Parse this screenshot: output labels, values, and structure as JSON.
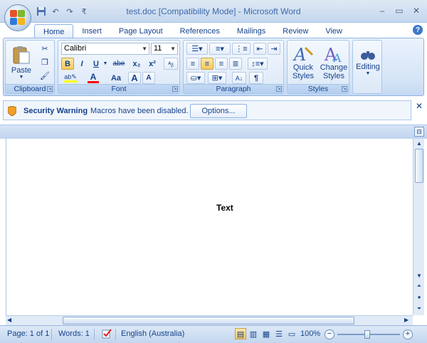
{
  "window": {
    "title": "test.doc [Compatibility Mode] - Microsoft Word",
    "controls": {
      "minimize": "–",
      "maximize": "▭",
      "close": "✕"
    }
  },
  "quick_access": {
    "customize": "₹"
  },
  "tabs": [
    {
      "label": "Home",
      "active": true
    },
    {
      "label": "Insert"
    },
    {
      "label": "Page Layout"
    },
    {
      "label": "References"
    },
    {
      "label": "Mailings"
    },
    {
      "label": "Review"
    },
    {
      "label": "View"
    }
  ],
  "ribbon": {
    "clipboard": {
      "label": "Clipboard",
      "paste_label": "Paste"
    },
    "font": {
      "label": "Font",
      "font_name": "Calibri",
      "font_size": "11",
      "bold": "B",
      "italic": "I",
      "underline": "U",
      "strikethrough": "abe",
      "subscript": "x₂",
      "superscript": "x²",
      "change_case": "Aa",
      "grow": "A",
      "shrink": "A"
    },
    "paragraph": {
      "label": "Paragraph",
      "show_marks": "¶"
    },
    "styles": {
      "label": "Styles",
      "quick_styles": "Quick Styles",
      "change_styles": "Change Styles"
    },
    "editing": {
      "label": "Editing"
    }
  },
  "security_bar": {
    "title": "Security Warning",
    "message": "Macros have been disabled.",
    "options_button": "Options...",
    "close": "✕"
  },
  "document": {
    "text": "Text"
  },
  "status_bar": {
    "page": "Page: 1 of 1",
    "words": "Words: 1",
    "language": "English (Australia)",
    "zoom": "100%"
  },
  "colors": {
    "accent": "#15428b",
    "ribbon_bg": "#d6e5f7",
    "active_toggle": "#f7c85a"
  }
}
